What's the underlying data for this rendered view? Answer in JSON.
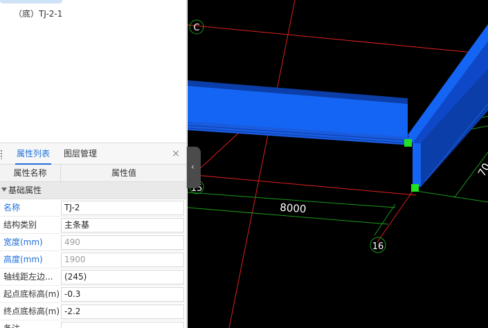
{
  "tree": {
    "item_label": "（底）TJ-2-1"
  },
  "properties_panel": {
    "tabs": [
      {
        "label": "属性列表",
        "active": true
      },
      {
        "label": "图层管理",
        "active": false
      }
    ],
    "close_symbol": "×",
    "columns": {
      "name": "属性名称",
      "value": "属性值"
    },
    "group_label": "基础属性",
    "rows": [
      {
        "name": "名称",
        "value": "TJ-2",
        "name_blue": true,
        "value_gray": false
      },
      {
        "name": "结构类别",
        "value": "主条基",
        "name_blue": false,
        "value_gray": false
      },
      {
        "name": "宽度(mm)",
        "value": "490",
        "name_blue": true,
        "value_gray": true
      },
      {
        "name": "高度(mm)",
        "value": "1900",
        "name_blue": true,
        "value_gray": true
      },
      {
        "name": "轴线距左边...",
        "value": "(245)",
        "name_blue": false,
        "value_gray": false
      },
      {
        "name": "起点底标高(m)",
        "value": "-0.3",
        "name_blue": false,
        "value_gray": false
      },
      {
        "name": "终点底标高(m)",
        "value": "-2.2",
        "name_blue": false,
        "value_gray": false
      },
      {
        "name": "备注",
        "value": "",
        "name_blue": false,
        "value_gray": false
      }
    ]
  },
  "collapse_handle": {
    "symbol": "‹"
  },
  "viewport": {
    "axis_labels": {
      "axis_c": "C",
      "axis_15": "15",
      "axis_16": "16"
    },
    "dimension_8000": "8000",
    "dimension_right_partial": "70",
    "colors": {
      "background": "#000000",
      "beam": "#1565f5",
      "beam_dark": "#0b3ea8",
      "red_axis": "#e02020",
      "green_dim": "#1a9a1a",
      "grip_point": "#22e022"
    }
  }
}
